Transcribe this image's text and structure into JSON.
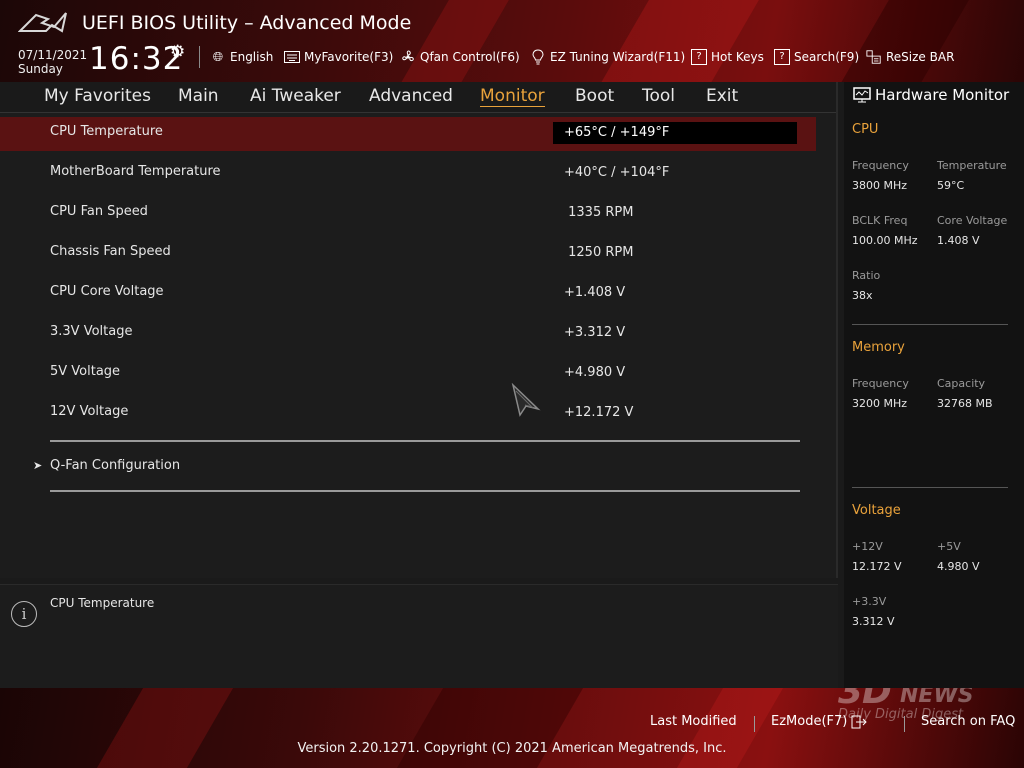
{
  "header": {
    "title": "UEFI BIOS Utility – Advanced Mode",
    "date": "07/11/2021",
    "day": "Sunday",
    "time": "16:32",
    "toolbar": [
      {
        "label": "English",
        "icon": "globe-icon"
      },
      {
        "label": "MyFavorite(F3)",
        "icon": "keyboard-icon"
      },
      {
        "label": "Qfan Control(F6)",
        "icon": "fan-icon"
      },
      {
        "label": "EZ Tuning Wizard(F11)",
        "icon": "lightbulb-icon"
      },
      {
        "label": "Hot Keys",
        "icon": "question-box-icon",
        "glyph": "?"
      },
      {
        "label": "Search(F9)",
        "icon": "search-box-icon",
        "glyph": "?"
      },
      {
        "label": "ReSize BAR",
        "icon": "resize-bar-icon"
      }
    ]
  },
  "menu": {
    "items": [
      "My Favorites",
      "Main",
      "Ai Tweaker",
      "Advanced",
      "Monitor",
      "Boot",
      "Tool",
      "Exit"
    ],
    "active": "Monitor"
  },
  "monitor": {
    "rows": [
      {
        "label": "CPU Temperature",
        "value": "+65°C / +149°F",
        "selected": true
      },
      {
        "label": "MotherBoard Temperature",
        "value": "+40°C / +104°F"
      },
      {
        "label": "CPU Fan Speed",
        "value": " 1335 RPM"
      },
      {
        "label": "Chassis Fan Speed",
        "value": " 1250 RPM"
      },
      {
        "label": "CPU Core Voltage",
        "value": "+1.408 V"
      },
      {
        "label": "3.3V Voltage",
        "value": "+3.312 V"
      },
      {
        "label": "5V Voltage",
        "value": "+4.980 V"
      },
      {
        "label": "12V Voltage",
        "value": "+12.172 V"
      }
    ],
    "submenu": "Q-Fan Configuration"
  },
  "help": {
    "text": "CPU Temperature"
  },
  "hardware_monitor": {
    "title": "Hardware Monitor",
    "cpu": {
      "heading": "CPU",
      "frequency_label": "Frequency",
      "frequency": "3800 MHz",
      "temperature_label": "Temperature",
      "temperature": "59°C",
      "bclk_label": "BCLK Freq",
      "bclk": "100.00 MHz",
      "core_voltage_label": "Core Voltage",
      "core_voltage": "1.408 V",
      "ratio_label": "Ratio",
      "ratio": "38x"
    },
    "memory": {
      "heading": "Memory",
      "frequency_label": "Frequency",
      "frequency": "3200 MHz",
      "capacity_label": "Capacity",
      "capacity": "32768 MB"
    },
    "voltage": {
      "heading": "Voltage",
      "v12_label": "+12V",
      "v12": "12.172 V",
      "v5_label": "+5V",
      "v5": "4.980 V",
      "v33_label": "+3.3V",
      "v33": "3.312 V"
    }
  },
  "footer": {
    "last_modified": "Last Modified",
    "ezmode": "EzMode(F7)",
    "search_faq": "Search on FAQ",
    "copyright": "Version 2.20.1271. Copyright (C) 2021 American Megatrends, Inc."
  },
  "watermark": {
    "brand": "3D",
    "news": "NEWS",
    "tagline": "Daily Digital Digest"
  },
  "colors": {
    "accent": "#e9a23b",
    "selected_row": "#5a1212",
    "header_red": "#7a0e0e"
  }
}
